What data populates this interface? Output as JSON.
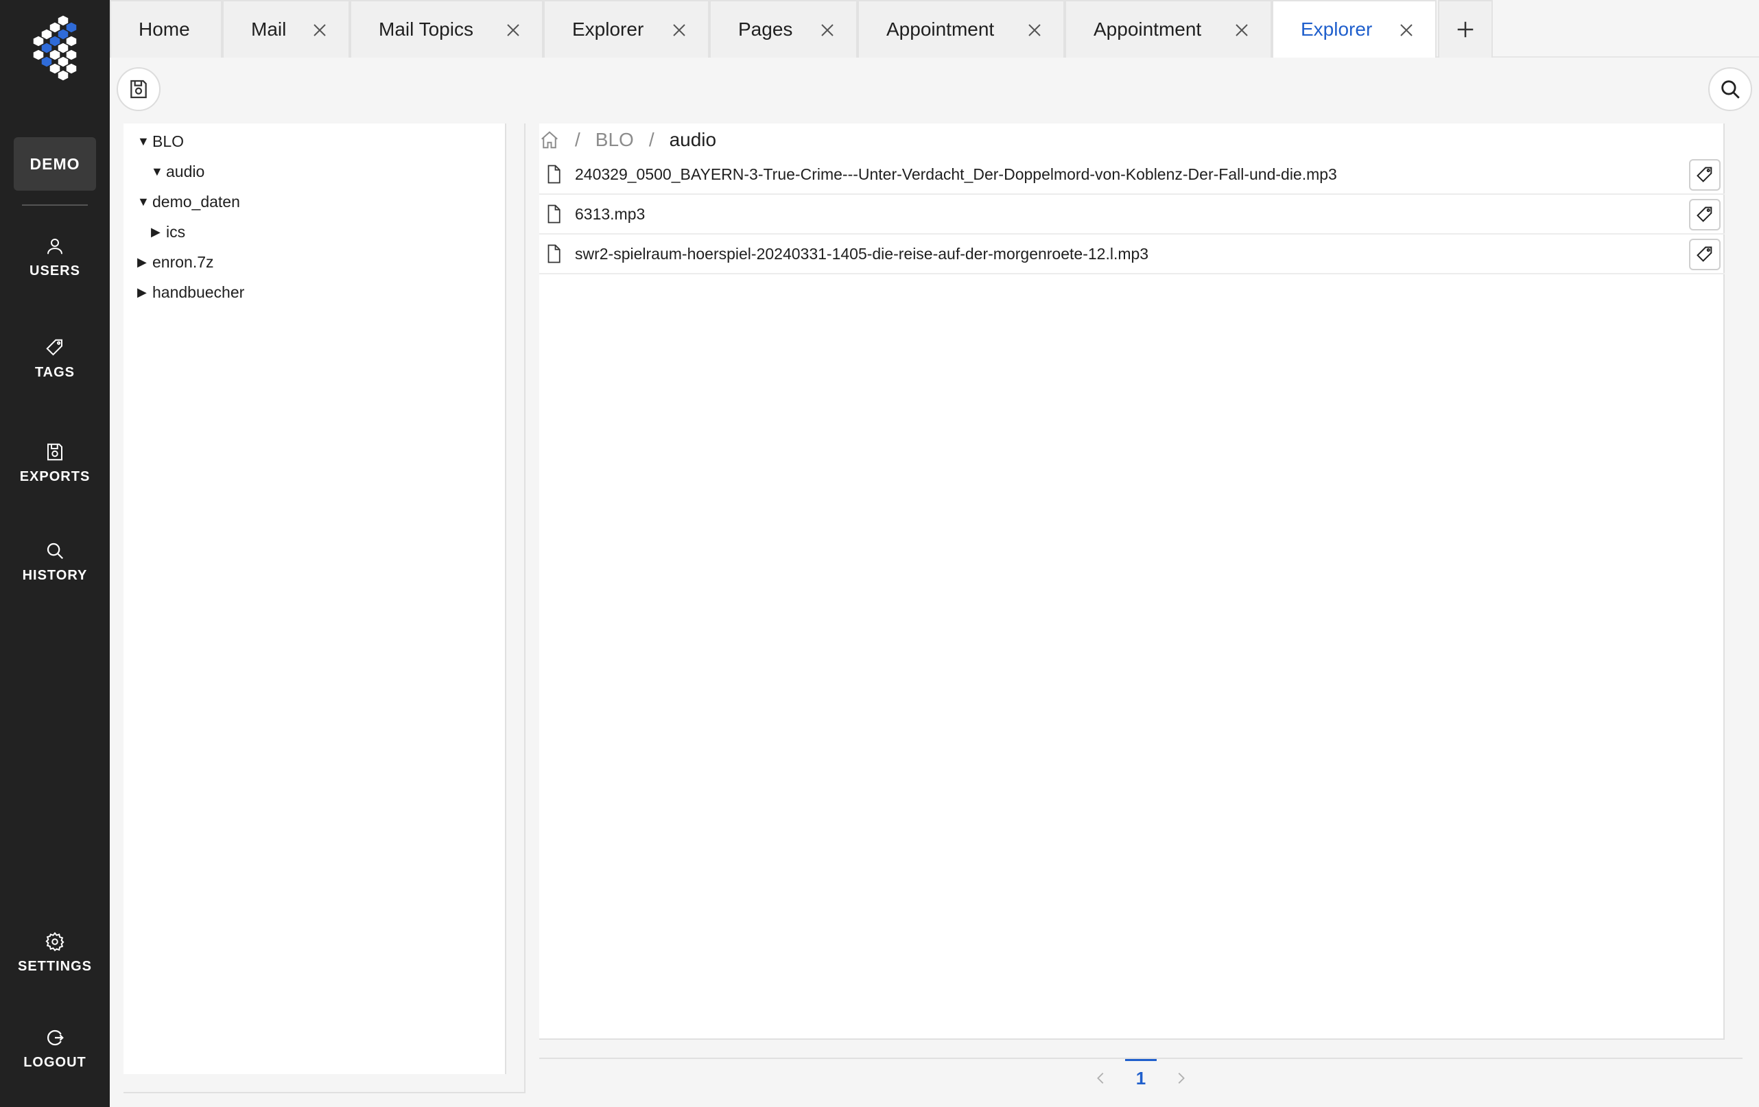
{
  "sidebar": {
    "workspace": "DEMO",
    "items": [
      {
        "key": "users",
        "label": "USERS",
        "icon": "user-icon"
      },
      {
        "key": "tags",
        "label": "TAGS",
        "icon": "tag-icon"
      },
      {
        "key": "exports",
        "label": "EXPORTS",
        "icon": "save-icon"
      },
      {
        "key": "history",
        "label": "HISTORY",
        "icon": "search-icon"
      }
    ],
    "bottom": [
      {
        "key": "settings",
        "label": "SETTINGS",
        "icon": "gear-icon"
      },
      {
        "key": "logout",
        "label": "LOGOUT",
        "icon": "logout-icon"
      }
    ]
  },
  "tabs": [
    {
      "label": "Home",
      "closable": false
    },
    {
      "label": "Mail",
      "closable": true
    },
    {
      "label": "Mail Topics",
      "closable": true
    },
    {
      "label": "Explorer",
      "closable": true
    },
    {
      "label": "Pages",
      "closable": true
    },
    {
      "label": "Appointment",
      "closable": true
    },
    {
      "label": "Appointment",
      "closable": true
    },
    {
      "label": "Explorer",
      "closable": true,
      "active": true
    }
  ],
  "tree": [
    {
      "label": "BLO",
      "expanded": true,
      "level": 0
    },
    {
      "label": "audio",
      "expanded": true,
      "level": 1
    },
    {
      "label": "demo_daten",
      "expanded": true,
      "level": 0
    },
    {
      "label": "ics",
      "expanded": false,
      "level": 1
    },
    {
      "label": "enron.7z",
      "expanded": false,
      "level": 0
    },
    {
      "label": "handbuecher",
      "expanded": false,
      "level": 0
    }
  ],
  "breadcrumb": {
    "home_icon": "home-icon",
    "separator": "/",
    "parts": [
      "BLO",
      "audio"
    ]
  },
  "files": [
    {
      "name": "240329_0500_BAYERN-3-True-Crime---Unter-Verdacht_Der-Doppelmord-von-Koblenz-Der-Fall-und-die.mp3"
    },
    {
      "name": "6313.mp3"
    },
    {
      "name": "swr2-spielraum-hoerspiel-20240331-1405-die-reise-auf-der-morgenroete-12.l.mp3"
    }
  ],
  "pagination": {
    "current": "1"
  },
  "colors": {
    "accent": "#1f5fcc",
    "sidebar_bg": "#222222"
  }
}
